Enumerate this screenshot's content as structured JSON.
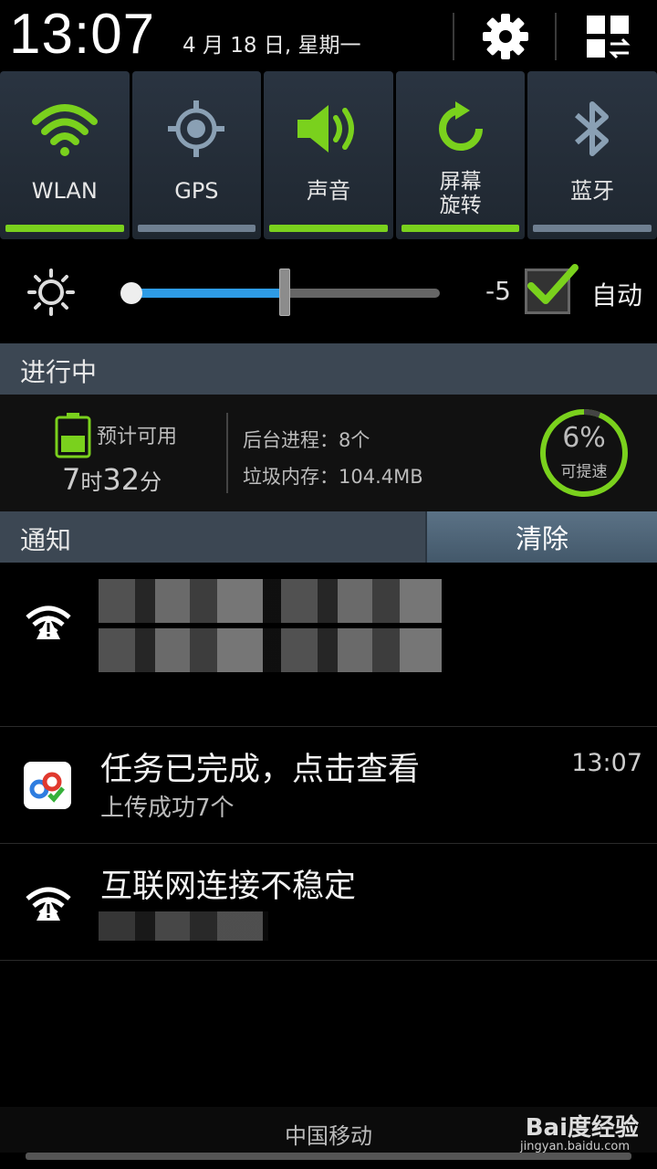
{
  "status": {
    "time": "13:07",
    "date": "4 月 18 日, 星期一"
  },
  "toggles": [
    {
      "label": "WLAN",
      "icon": "wifi-icon",
      "on": true
    },
    {
      "label": "GPS",
      "icon": "gps-icon",
      "on": false
    },
    {
      "label": "声音",
      "icon": "sound-icon",
      "on": true
    },
    {
      "label_line1": "屏幕",
      "label_line2": "旋转",
      "icon": "rotate-icon",
      "on": true
    },
    {
      "label": "蓝牙",
      "icon": "bluetooth-icon",
      "on": false
    }
  ],
  "brightness": {
    "value": "-5",
    "auto_label": "自动",
    "auto_checked": true,
    "level": 0.5
  },
  "ongoing": {
    "title": "进行中",
    "battery_label": "预计可用",
    "battery_hours": "7",
    "battery_h_unit": "时",
    "battery_minutes": "32",
    "battery_m_unit": "分",
    "bg_process": "后台进程：8个",
    "junk_memory": "垃圾内存：104.4MB",
    "boost_percent": "6%",
    "boost_label": "可提速"
  },
  "notifications_header": {
    "title": "通知",
    "clear_label": "清除"
  },
  "notifications": [
    {
      "icon": "wifi-warning-icon",
      "title": "",
      "subtitle": "",
      "time": ""
    },
    {
      "icon": "baidu-cloud-icon",
      "title": "任务已完成，点击查看",
      "subtitle": "上传成功7个",
      "time": "13:07"
    },
    {
      "icon": "wifi-warning-icon",
      "title": "互联网连接不稳定",
      "subtitle": "",
      "time": ""
    }
  ],
  "carrier": "中国移动",
  "watermark": {
    "brand": "Bai度经验",
    "url": "jingyan.baidu.com"
  },
  "colors": {
    "accent_green": "#7ad11d",
    "accent_blue": "#2e9ce6",
    "toggle_bg": "#2a3441"
  }
}
